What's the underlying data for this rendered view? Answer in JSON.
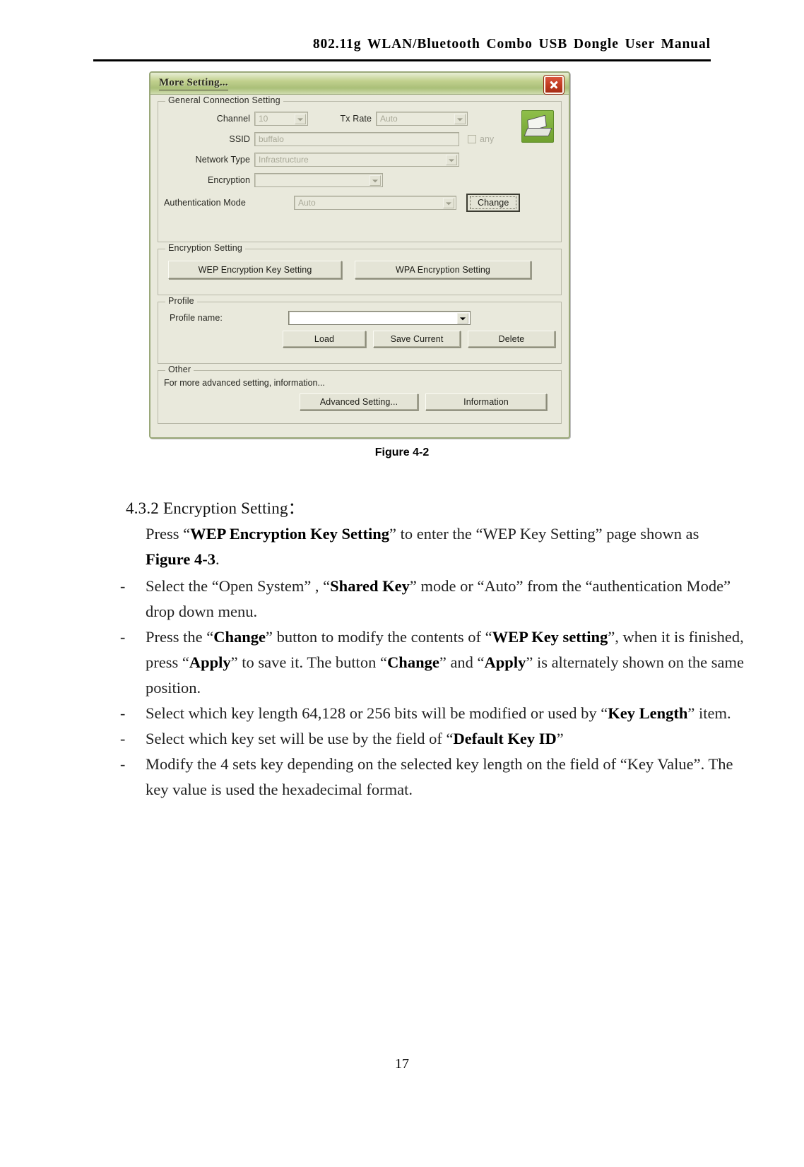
{
  "document": {
    "header_title": "802.11g WLAN/Bluetooth Combo USB Dongle User Manual",
    "page_number": "17",
    "figure_caption": "Figure 4-2"
  },
  "dialog": {
    "title": "More Setting...",
    "close_label": "close-window",
    "groups": {
      "general": {
        "legend": "General Connection Setting",
        "channel_label": "Channel",
        "channel_value": "10",
        "tx_rate_label": "Tx Rate",
        "tx_rate_value": "Auto",
        "ssid_label": "SSID",
        "ssid_value": "buffalo",
        "any_label": "any",
        "network_type_label": "Network Type",
        "network_type_value": "Infrastructure",
        "encryption_label": "Encryption",
        "encryption_value": "",
        "auth_mode_label": "Authentication Mode",
        "auth_mode_value": "Auto",
        "change_button": "Change"
      },
      "encryption": {
        "legend": "Encryption Setting",
        "wep_button": "WEP Encryption Key Setting",
        "wpa_button": "WPA Encryption Setting"
      },
      "profile": {
        "legend": "Profile",
        "profile_name_label": "Profile name:",
        "profile_name_value": "",
        "load_button": "Load",
        "save_current_button": "Save Current",
        "delete_button": "Delete"
      },
      "other": {
        "legend": "Other",
        "description": "For more advanced setting, information...",
        "advanced_button": "Advanced Setting...",
        "information_button": "Information"
      }
    }
  },
  "content": {
    "section_heading": "4.3.2 Encryption Setting：",
    "lead_paragraph": {
      "part1": "Press “",
      "bold1": "WEP Encryption Key Setting",
      "part2": "” to enter the “WEP Key Setting” page shown as ",
      "bold2": "Figure 4-3",
      "part3": "."
    },
    "bullets": [
      {
        "dash": "-",
        "p1": "Select the “Open System” , “",
        "b1": "Shared Key",
        "p2": "” mode or “Auto” from the “authentication Mode” drop down menu.",
        "b2": "",
        "p3": ""
      },
      {
        "dash": "-",
        "p1": "Press the “",
        "b1": "Change",
        "p2": "” button to modify the contents of “",
        "b2": "WEP Key setting",
        "p3": "”, when it is finished, press “",
        "b3": "Apply",
        "p4": "” to save it. The button “",
        "b4": "Change",
        "p5": "” and “",
        "b5": "Apply",
        "p6": "” is alternately shown on the same position."
      },
      {
        "dash": "-",
        "p1": "Select which key length 64,128 or 256 bits will be modified or used by “",
        "b1": "Key Length",
        "p2": "” item.",
        "b2": "",
        "p3": ""
      },
      {
        "dash": "-",
        "p1": "Select which key set will be use by the field of “",
        "b1": "Default Key ID",
        "p2": "”",
        "b2": "",
        "p3": ""
      },
      {
        "dash": "-",
        "p1": "Modify the 4 sets key depending on the selected key length on the field of “Key Value”. The key value is used the hexadecimal format.",
        "b1": "",
        "p2": "",
        "b2": "",
        "p3": ""
      }
    ]
  }
}
